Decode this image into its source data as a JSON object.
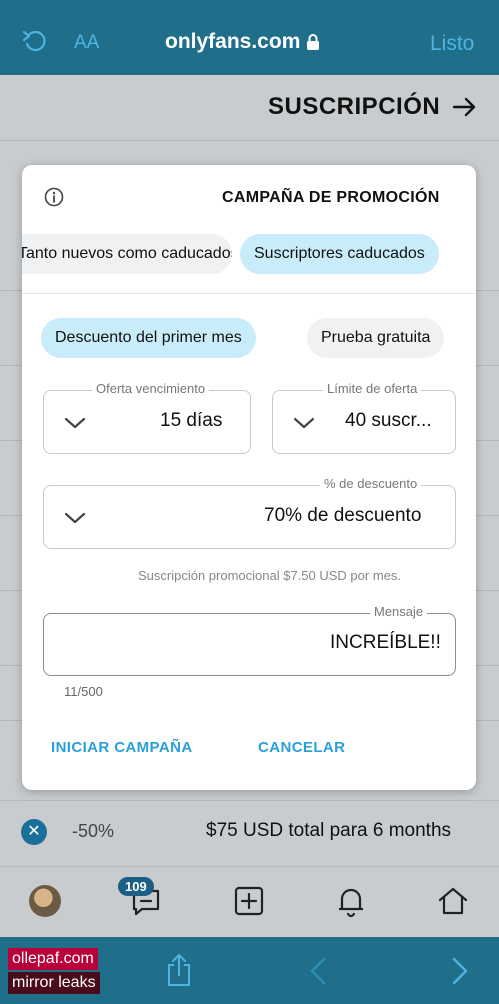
{
  "browser": {
    "done_label": "Listo",
    "url": "onlyfans.com",
    "text_size_label": "AA"
  },
  "page": {
    "title": "SUSCRIPCIÓN"
  },
  "modal": {
    "title": "CAMPAÑA DE PROMOCIÓN",
    "audience_tabs": [
      {
        "label": "Suscriptores caducados",
        "active": true
      },
      {
        "label": "Tanto nuevos como caducados",
        "active": false
      }
    ],
    "type_tabs": [
      {
        "label": "Prueba gratuita",
        "active": false
      },
      {
        "label": "Descuento del primer mes",
        "active": true
      }
    ],
    "offer_limit": {
      "label": "Límite de oferta",
      "value": "40 suscr..."
    },
    "offer_expiry": {
      "label": "Oferta vencimiento",
      "value": "15 días"
    },
    "discount": {
      "label": "% de descuento",
      "value": "70% de descuento"
    },
    "helper_text": "Suscripción promocional $7.50 USD por mes.",
    "message": {
      "label": "Mensaje",
      "value": "INCREÍBLE!!",
      "counter": "11/500"
    },
    "cancel_label": "CANCELAR",
    "start_label": "INICIAR CAMPAÑA"
  },
  "background_offer": {
    "text": "$75 USD total para 6 months",
    "discount": "-50%"
  },
  "nav": {
    "badge_count": "109"
  },
  "watermark": {
    "line1": "ollepaf.com",
    "line2": "mirror leaks"
  },
  "colors": {
    "accent": "#2aa0d8",
    "chip_active": "#c9ecfa",
    "browser_bar": "#1f6f8a"
  }
}
